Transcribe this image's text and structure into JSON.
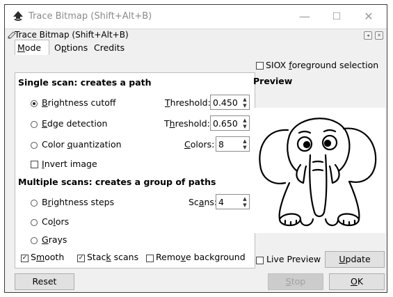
{
  "window": {
    "title": "Trace Bitmap (Shift+Alt+B)",
    "minimize": "—",
    "maximize": "☐",
    "close": "✕"
  },
  "dock": {
    "title": "Trace Bitmap (Shift+Alt+B)"
  },
  "tabs": [
    {
      "pre": "",
      "key": "M",
      "post": "ode"
    },
    {
      "pre": "O",
      "key": "p",
      "post": "tions"
    },
    {
      "pre": "Credits",
      "key": "",
      "post": ""
    }
  ],
  "mode": {
    "single_heading": "Single scan: creates a path",
    "brightness": {
      "pre": "",
      "key": "B",
      "post": "rightness cutoff",
      "selected": true
    },
    "brightness_threshold_label": {
      "pre": "",
      "key": "T",
      "post": "hreshold:"
    },
    "brightness_threshold_value": "0.450",
    "edge": {
      "pre": "",
      "key": "E",
      "post": "dge detection"
    },
    "edge_threshold_label": {
      "pre": "T",
      "key": "h",
      "post": "reshold:"
    },
    "edge_threshold_value": "0.650",
    "color_q": {
      "pre": "Color ",
      "key": "q",
      "post": "uantization"
    },
    "colors_label": {
      "pre": "",
      "key": "C",
      "post": "olors:"
    },
    "colors_value": "8",
    "invert": {
      "pre": "",
      "key": "I",
      "post": "nvert image"
    },
    "multi_heading": "Multiple scans: creates a group of paths",
    "bsteps": {
      "pre": "B",
      "key": "r",
      "post": "ightness steps"
    },
    "scans_label": {
      "pre": "Sc",
      "key": "a",
      "post": "ns:"
    },
    "scans_value": "4",
    "colors_multi": {
      "pre": "Co",
      "key": "l",
      "post": "ors"
    },
    "grays": {
      "pre": "",
      "key": "G",
      "post": "rays"
    },
    "smooth": {
      "pre": "S",
      "key": "m",
      "post": "ooth"
    },
    "stack": {
      "pre": "Stac",
      "key": "k",
      "post": " scans"
    },
    "remove_bg": {
      "pre": "Remo",
      "key": "v",
      "post": "e background"
    }
  },
  "siox": {
    "pre": "SIOX ",
    "key": "f",
    "post": "oreground selection"
  },
  "preview_label": "Preview",
  "live_preview": "Live Preview",
  "update": {
    "pre": "",
    "key": "U",
    "post": "pdate"
  },
  "buttons": {
    "reset": "Reset",
    "stop": {
      "pre": "",
      "key": "S",
      "post": "top"
    },
    "ok": {
      "pre": "",
      "key": "O",
      "post": "K"
    }
  },
  "colors": {
    "accent_icon": "#2b2b2b"
  }
}
